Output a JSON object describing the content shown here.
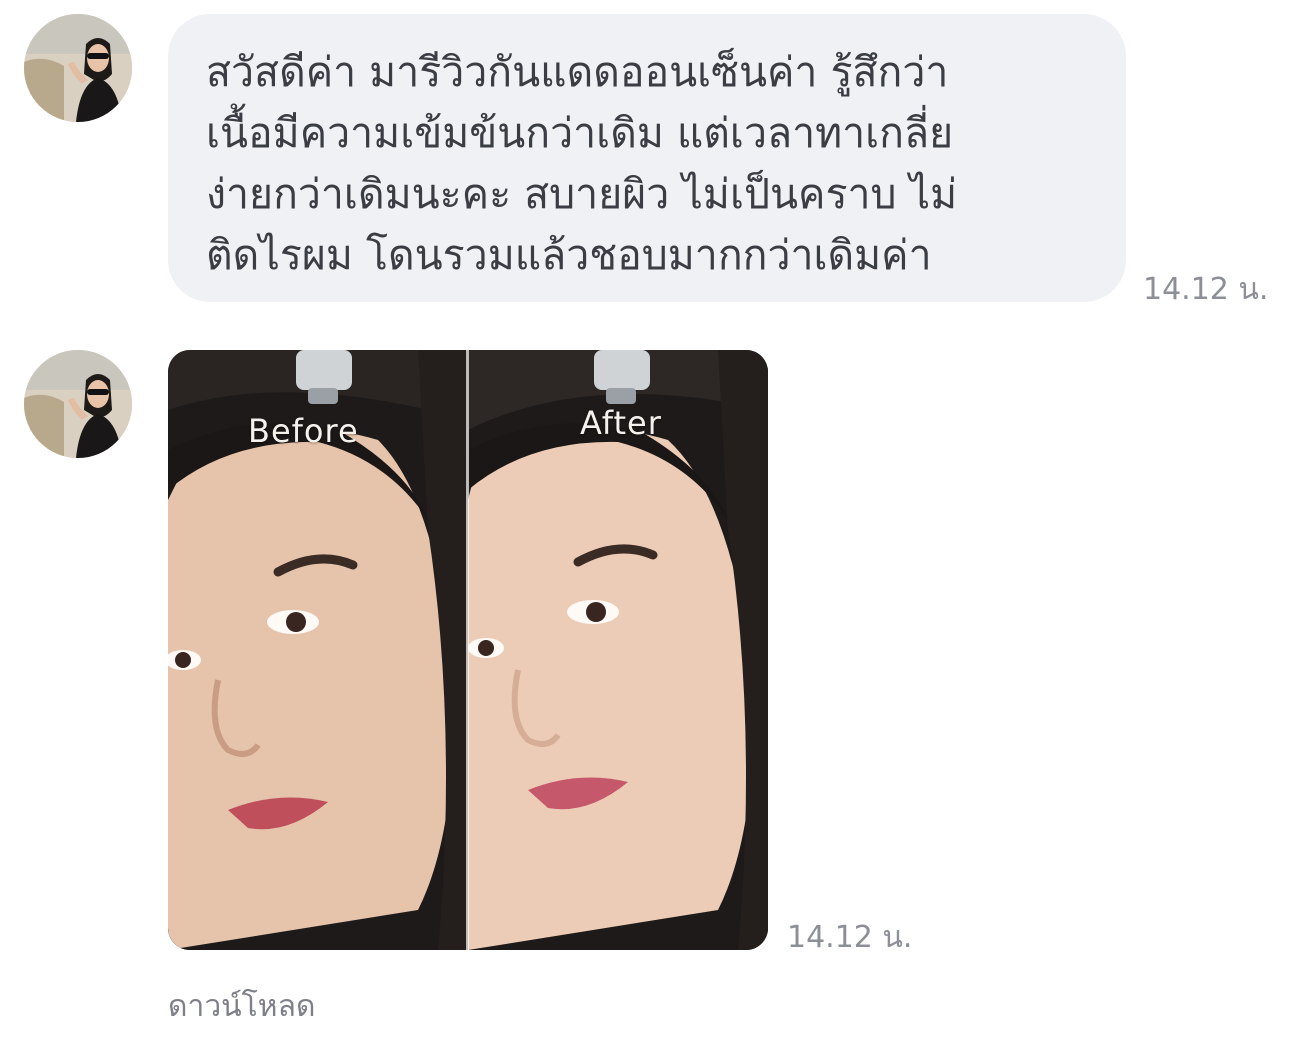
{
  "messages": [
    {
      "type": "text",
      "avatar": "sender-avatar",
      "lines": [
        "สวัสดีค่า มารีวิวกันแดดออนเซ็นค่า รู้สึกว่า",
        "เนื้อมีความเข้มข้นกว่าเดิม แต่เวลาทาเกลี่ย",
        "ง่ายกว่าเดิมนะคะ สบายผิว ไม่เป็นคราบ ไม่",
        "ติดไรผม โดนรวมแล้วชอบมากกว่าเดิมค่า"
      ],
      "time": "14.12 น."
    },
    {
      "type": "image",
      "avatar": "sender-avatar",
      "image": {
        "description_icon": "before-after-face-photo",
        "left_label": "Before",
        "right_label": "After"
      },
      "time": "14.12 น.",
      "download_label": "ดาวน์โหลด"
    }
  ],
  "colors": {
    "bubble": "#eff1f4",
    "text": "#3a3d44",
    "time": "#8c8f96",
    "link": "#7d8088"
  }
}
